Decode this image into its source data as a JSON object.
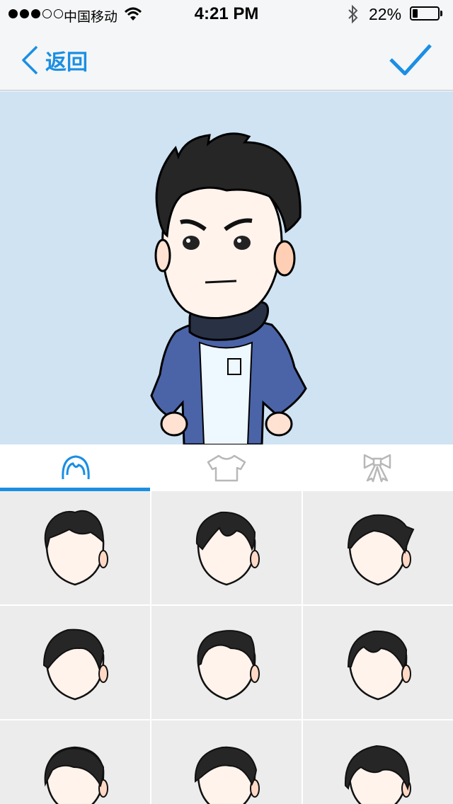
{
  "status_bar": {
    "carrier": "中国移动",
    "time": "4:21 PM",
    "battery_percent": "22%",
    "battery_level": 0.22,
    "signal_bars_filled": 3,
    "signal_bars_total": 5
  },
  "nav": {
    "back_label": "返回",
    "back_icon": "chevron-left-icon",
    "confirm_icon": "checkmark-icon",
    "accent_color": "#1a8fe3"
  },
  "tabs": [
    {
      "icon": "hair-icon",
      "selected": true
    },
    {
      "icon": "tshirt-icon",
      "selected": false
    },
    {
      "icon": "bow-icon",
      "selected": false
    }
  ],
  "hair_options": [
    {
      "icon": "hairstyle-icon"
    },
    {
      "icon": "hairstyle-icon"
    },
    {
      "icon": "hairstyle-icon"
    },
    {
      "icon": "hairstyle-icon"
    },
    {
      "icon": "hairstyle-icon"
    },
    {
      "icon": "hairstyle-icon"
    },
    {
      "icon": "hairstyle-icon"
    },
    {
      "icon": "hairstyle-icon"
    },
    {
      "icon": "hairstyle-icon"
    }
  ]
}
